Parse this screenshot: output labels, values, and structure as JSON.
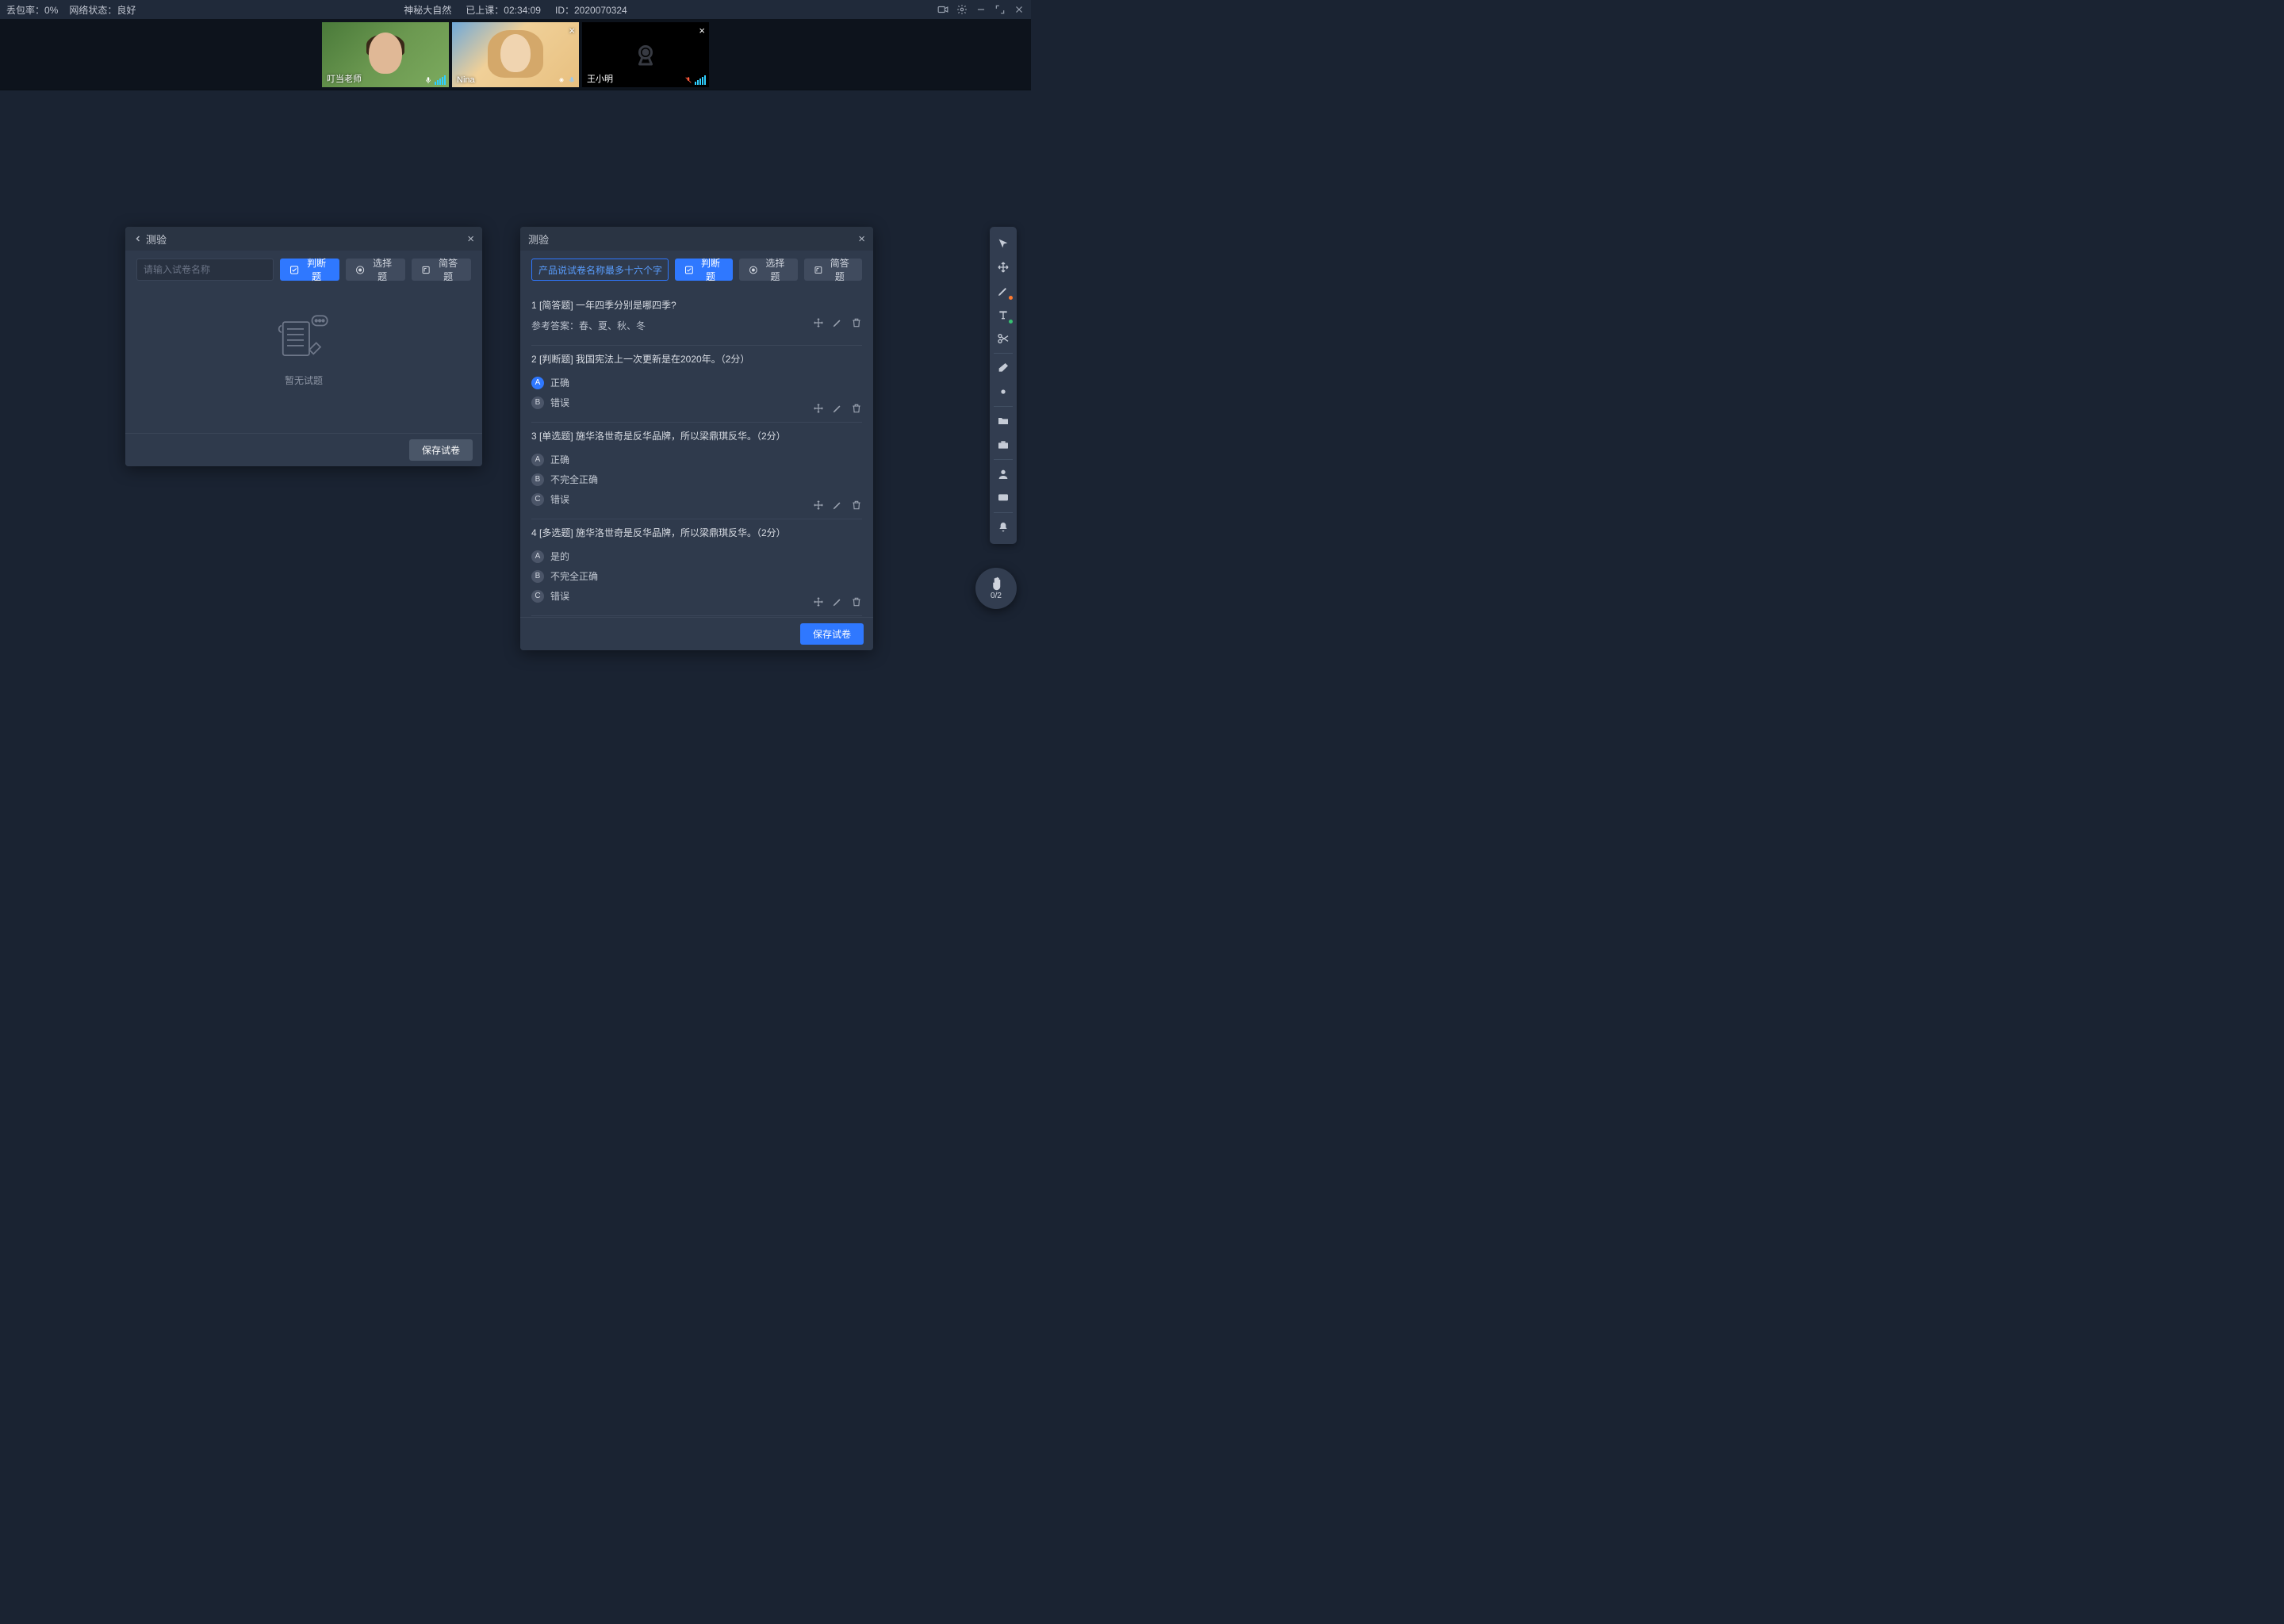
{
  "topbar": {
    "loss_rate": "丢包率：0%",
    "network": "网络状态：良好",
    "title": "神秘大自然",
    "elapsed": "已上课：02:34:09",
    "id": "ID：2020070324"
  },
  "videos": [
    {
      "name": "叮当老师",
      "has_close": false,
      "cam_off": false,
      "mic_on": true,
      "style": "teacher"
    },
    {
      "name": "Nina",
      "has_close": true,
      "cam_off": false,
      "mic_on": true,
      "style": "nina"
    },
    {
      "name": "王小明",
      "has_close": true,
      "cam_off": true,
      "mic_on": true,
      "style": "off"
    }
  ],
  "panels": {
    "left": {
      "title": "测验",
      "name_placeholder": "请输入试卷名称",
      "btn_tf": "判断题",
      "btn_choice": "选择题",
      "btn_short": "简答题",
      "empty_text": "暂无试题",
      "save_label": "保存试卷"
    },
    "right": {
      "title": "测验",
      "name_value": "产品说试卷名称最多十六个字",
      "btn_tf": "判断题",
      "btn_choice": "选择题",
      "btn_short": "简答题",
      "save_label": "保存试卷",
      "questions": [
        {
          "title": "1 [简答题] 一年四季分别是哪四季?",
          "ref": "参考答案：春、夏、秋、冬",
          "options": []
        },
        {
          "title": "2 [判断题] 我国宪法上一次更新是在2020年。（2分）",
          "options": [
            {
              "letter": "A",
              "text": "正确",
              "selected": true
            },
            {
              "letter": "B",
              "text": "错误",
              "selected": false
            }
          ]
        },
        {
          "title": "3 [单选题] 施华洛世奇是反华品牌，所以梁鼎琪反华。（2分）",
          "options": [
            {
              "letter": "A",
              "text": "正确",
              "selected": false
            },
            {
              "letter": "B",
              "text": "不完全正确",
              "selected": false
            },
            {
              "letter": "C",
              "text": "错误",
              "selected": false
            }
          ]
        },
        {
          "title": "4 [多选题] 施华洛世奇是反华品牌，所以梁鼎琪反华。（2分）",
          "options": [
            {
              "letter": "A",
              "text": "是的",
              "selected": false
            },
            {
              "letter": "B",
              "text": "不完全正确",
              "selected": false
            },
            {
              "letter": "C",
              "text": "错误",
              "selected": false
            }
          ]
        }
      ]
    }
  },
  "handraise": {
    "count": "0/2"
  },
  "colors": {
    "accent_orange": "#ff7a2f",
    "accent_green": "#38c172"
  }
}
